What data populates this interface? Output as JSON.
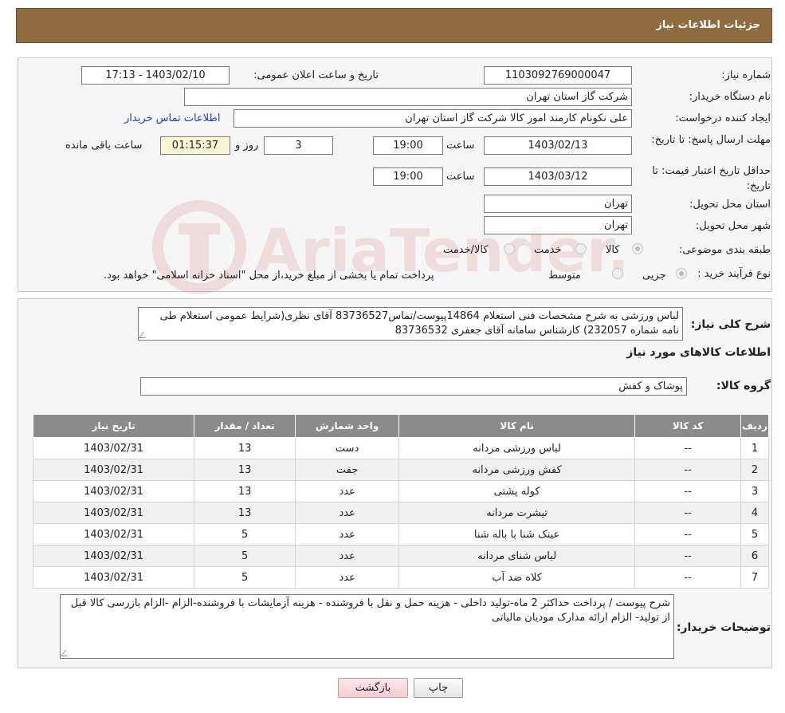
{
  "header": {
    "title": "جزئیات اطلاعات نیاز"
  },
  "info": {
    "need_number_label": "شماره نیاز:",
    "need_number": "1103092769000047",
    "announce_label": "تاریخ و ساعت اعلان عمومی:",
    "announce_value": "1403/02/10 - 17:13",
    "buyer_org_label": "نام دستگاه خریدار:",
    "buyer_org": "شرکت گاز استان تهران",
    "creator_label": "ایجاد کننده درخواست:",
    "creator": "علی نکونام کارمند امور کالا شرکت گاز استان تهران",
    "contact_link": "اطلاعات تماس خریدار",
    "deadline_label": "مهلت ارسال پاسخ: تا تاریخ:",
    "deadline_date": "1403/02/13",
    "time_label": "ساعت",
    "deadline_time": "19:00",
    "days": "3",
    "days_suffix": "روز و",
    "remaining_time": "01:15:37",
    "remaining_label": "ساعت باقی مانده",
    "validity_label": "حداقل تاریخ اعتبار قیمت: تا تاریخ:",
    "validity_date": "1403/03/12",
    "validity_time": "19:00",
    "province_label": "استان محل تحویل:",
    "province": "تهران",
    "city_label": "شهر محل تحویل:",
    "city": "تهران",
    "category_label": "طبقه بندی موضوعی:",
    "category_options": [
      "کالا",
      "خدمت",
      "کالا/خدمت"
    ],
    "process_label": "نوع فرآیند خرید :",
    "process_options": [
      "جزیی",
      "متوسط"
    ],
    "process_note": "پرداخت تمام یا بخشی از مبلغ خرید،از محل \"اسناد خزانه اسلامی\" خواهد بود."
  },
  "description": {
    "label": "شرح کلی نیاز:",
    "text": "لباس ورزشی به شرح مشخصات فنی استعلام 14864پیوست/تماس83736527 آقای نظری(شرایط عمومی استعلام طی نامه شماره 232057) کارشناس سامانه آقای جعفری 83736532"
  },
  "goods": {
    "section_title": "اطلاعات کالاهای مورد نیاز",
    "group_label": "گروه کالا:",
    "group_value": "پوشاک و کفش",
    "columns": [
      "ردیف",
      "کد کالا",
      "نام کالا",
      "واحد شمارش",
      "تعداد / مقدار",
      "تاریخ نیاز"
    ],
    "rows": [
      [
        "1",
        "--",
        "لباس ورزشی مردانه",
        "دست",
        "13",
        "1403/02/31"
      ],
      [
        "2",
        "--",
        "کفش ورزشی مردانه",
        "جفت",
        "13",
        "1403/02/31"
      ],
      [
        "3",
        "--",
        "کوله پشتی",
        "عدد",
        "13",
        "1403/02/31"
      ],
      [
        "4",
        "--",
        "تیشرت مردانه",
        "عدد",
        "13",
        "1403/02/31"
      ],
      [
        "5",
        "--",
        "عینک شنا با باله شنا",
        "عدد",
        "5",
        "1403/02/31"
      ],
      [
        "6",
        "--",
        "لباس شنای مردانه",
        "عدد",
        "5",
        "1403/02/31"
      ],
      [
        "7",
        "--",
        "کلاه ضد آب",
        "عدد",
        "5",
        "1403/02/31"
      ]
    ]
  },
  "buyer_notes": {
    "label": "توضیحات خریدار:",
    "text": "شرح پیوست / پرداخت حداکثر 2 ماه-تولید داخلی - هزینه حمل و نقل با فروشنده - هزینه آزمایشات با فروشنده-الزام  -الزام بازرسی کالا قبل از تولید- الزام ارائه مدارک مودیان مالیاتی"
  },
  "buttons": {
    "print": "چاپ",
    "back": "بازگشت"
  },
  "watermark": {
    "text": "AriaTender.neT"
  },
  "colors": {
    "header_bg": "#8f6c3f",
    "table_header_bg": "#8b8b8b",
    "link": "#1a3fc8"
  }
}
